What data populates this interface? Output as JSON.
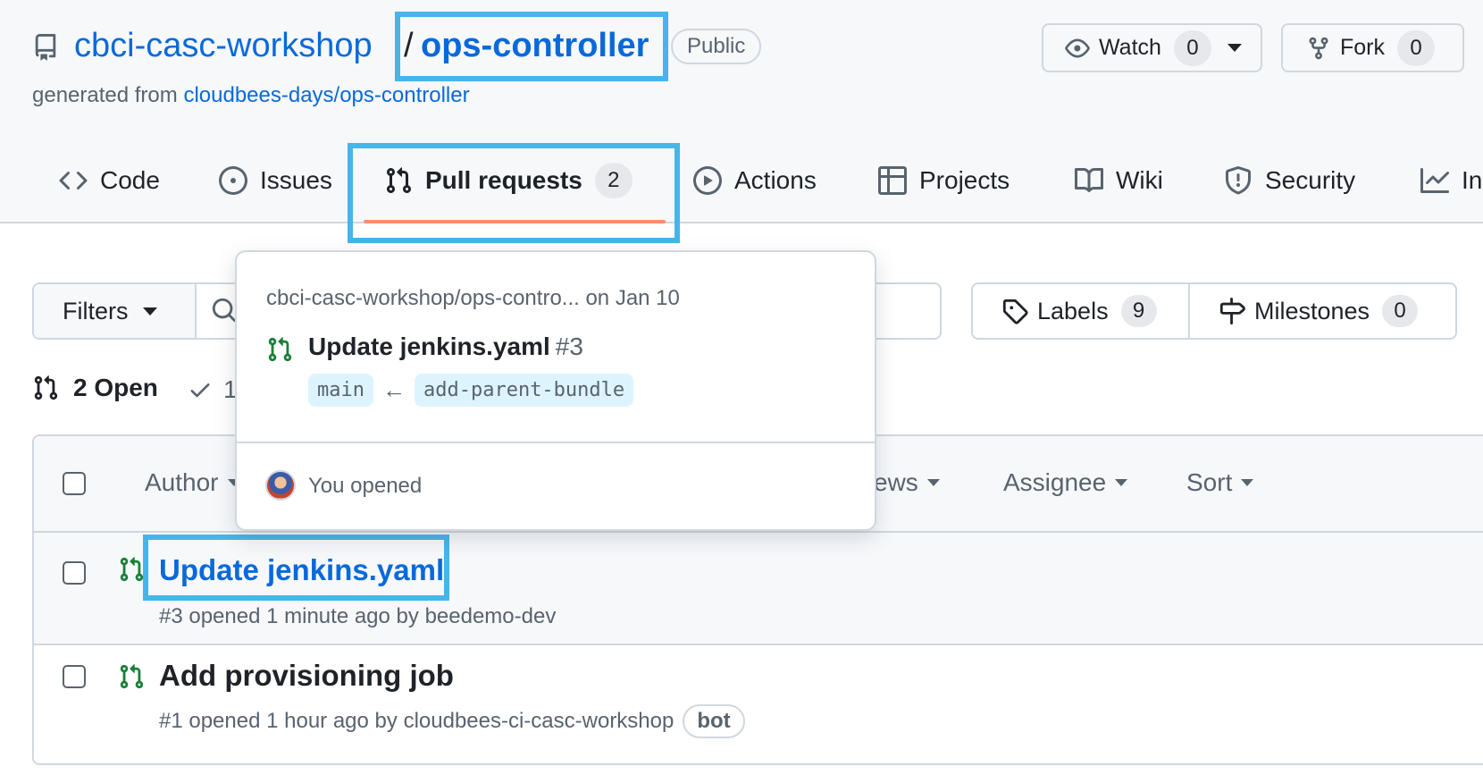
{
  "repo": {
    "owner": "cbci-casc-workshop",
    "separator": "/",
    "name": "ops-controller",
    "visibility": "Public",
    "generated_prefix": "generated from",
    "template": "cloudbees-days/ops-controller"
  },
  "actions": {
    "watch_label": "Watch",
    "watch_count": "0",
    "fork_label": "Fork",
    "fork_count": "0"
  },
  "nav": {
    "code": "Code",
    "issues": "Issues",
    "pull_requests": "Pull requests",
    "pull_requests_count": "2",
    "actions": "Actions",
    "projects": "Projects",
    "wiki": "Wiki",
    "security": "Security",
    "insights": "In",
    "active": "pull_requests"
  },
  "toolbar": {
    "filters_label": "Filters",
    "labels_label": "Labels",
    "labels_count": "9",
    "milestones_label": "Milestones",
    "milestones_count": "0"
  },
  "state_tabs": {
    "open": "2 Open",
    "closed": "1"
  },
  "list_header": {
    "author": "Author",
    "reviews": "ews",
    "assignee": "Assignee",
    "sort": "Sort"
  },
  "pull_requests": [
    {
      "title": "Update jenkins.yaml",
      "meta": "#3 opened 1 minute ago by beedemo-dev"
    },
    {
      "title": "Add provisioning job",
      "meta": "#1 opened 1 hour ago by cloudbees-ci-casc-workshop",
      "badge": "bot"
    }
  ],
  "popover": {
    "repo_line": "cbci-casc-workshop/ops-contro... on Jan 10",
    "title": "Update jenkins.yaml",
    "number": "#3",
    "base_branch": "main",
    "arrow": "←",
    "head_branch": "add-parent-bundle",
    "footer": "You opened"
  },
  "colors": {
    "link": "#0969da",
    "highlight": "#46b5ea",
    "active_underline": "#fd8c73",
    "open_pr": "#1a7f37"
  }
}
